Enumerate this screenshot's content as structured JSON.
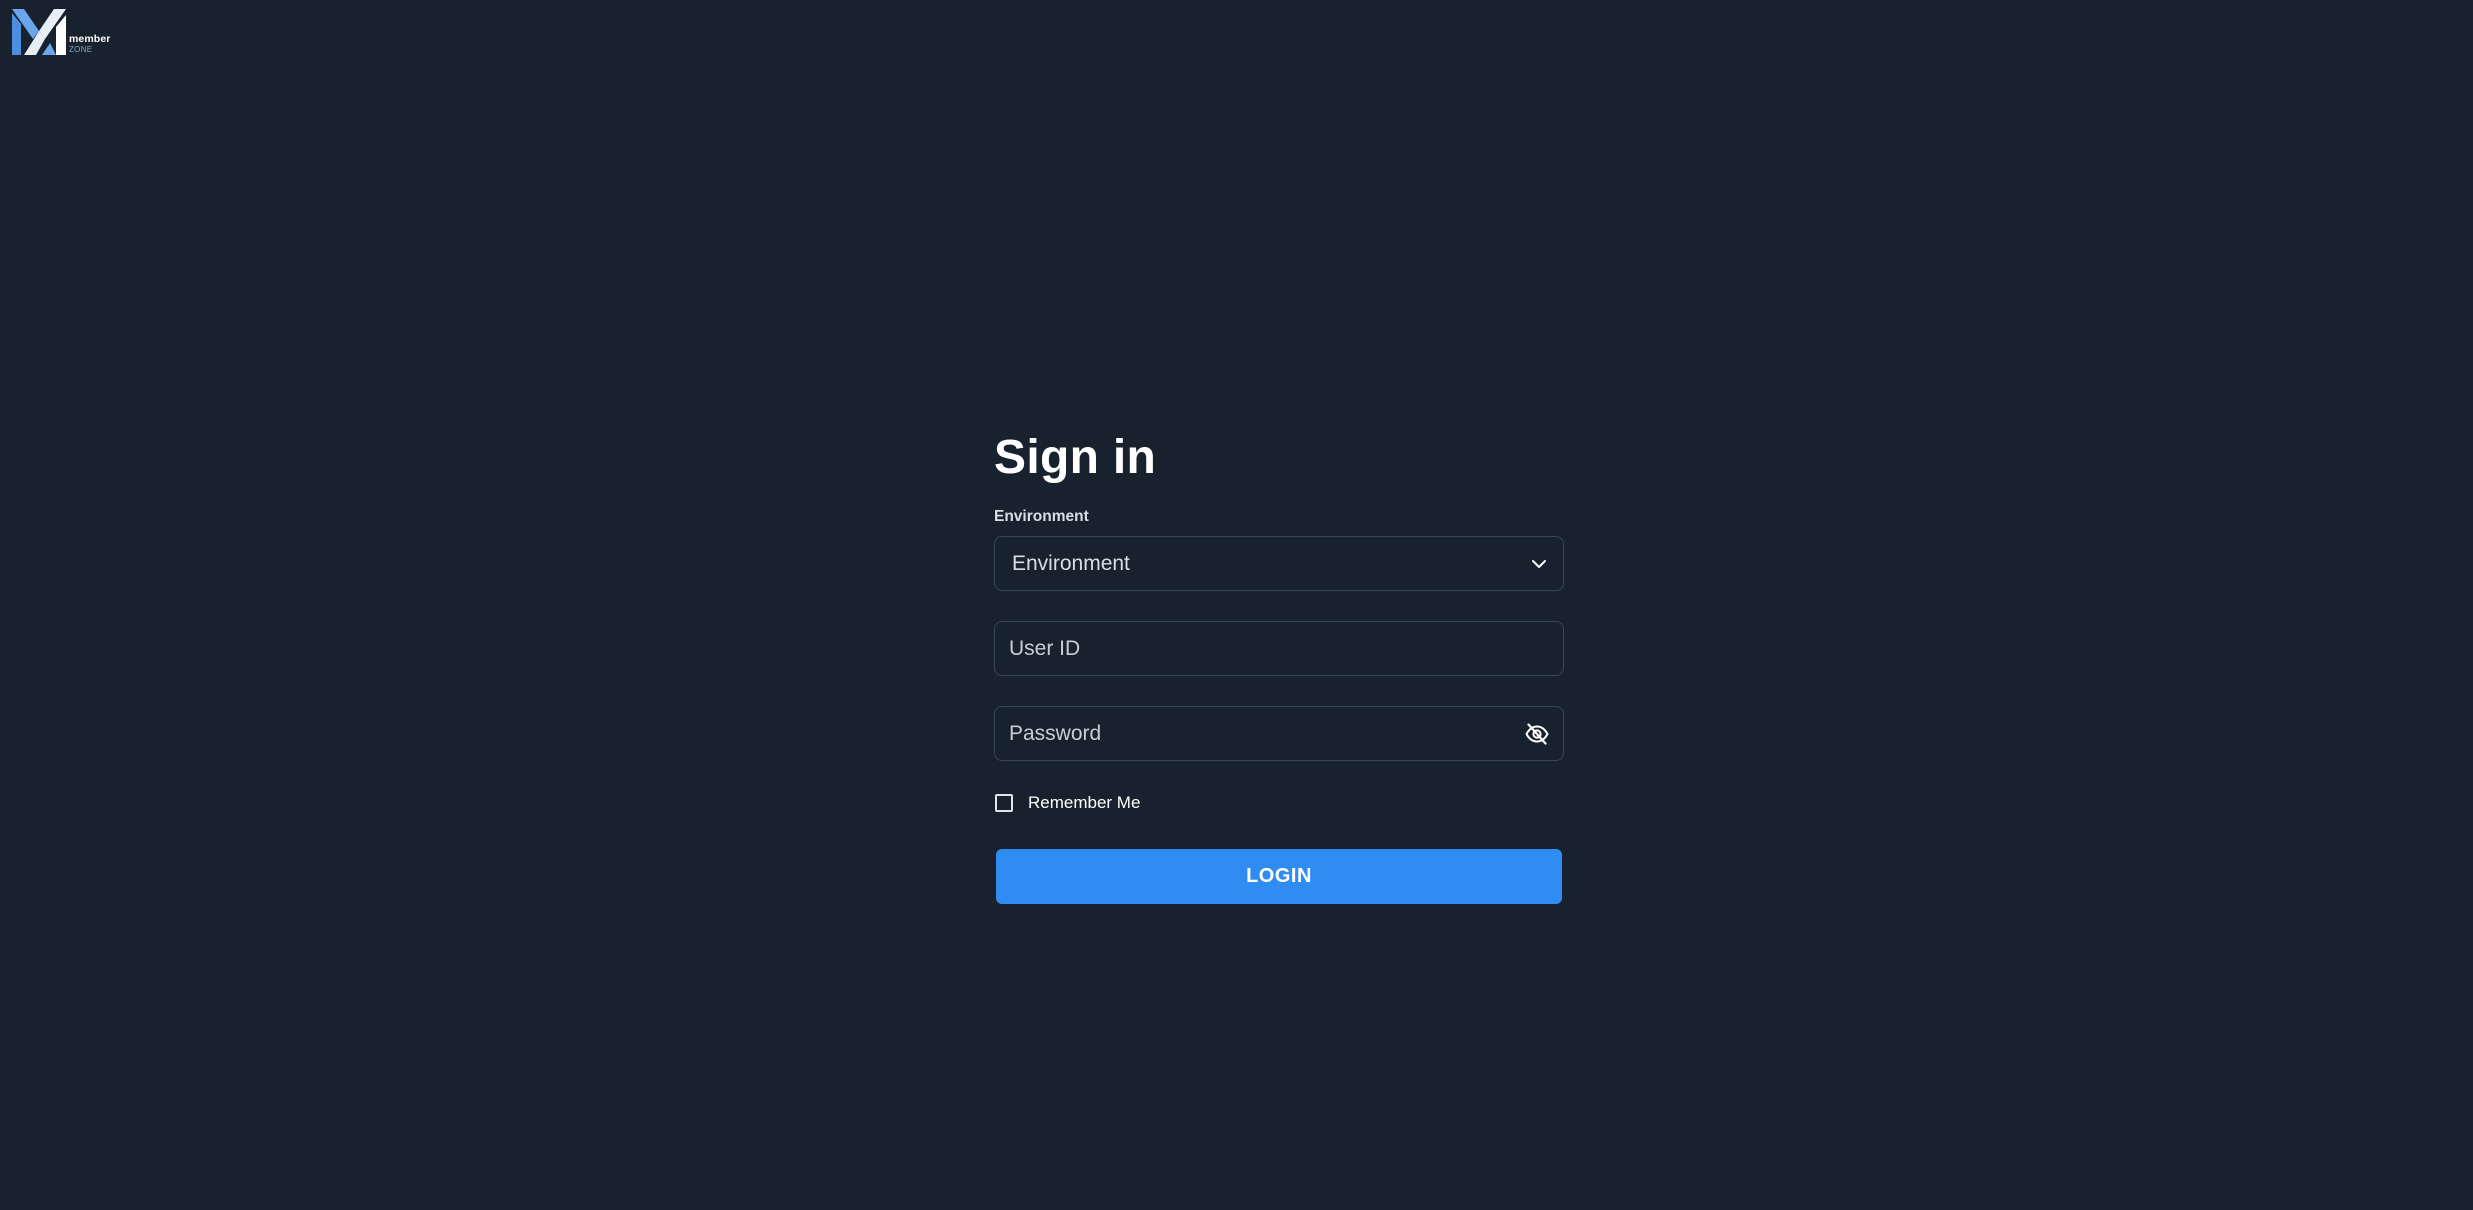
{
  "brand": {
    "logo_line1": "member",
    "logo_line2": "ZONE",
    "accent_color": "#2f8cf2",
    "background_color": "#18222f"
  },
  "form": {
    "title": "Sign in",
    "environment": {
      "label": "Environment",
      "selected_value": "Environment",
      "icon": "chevron-down-icon"
    },
    "user_id": {
      "value": "",
      "placeholder": "User ID"
    },
    "password": {
      "value": "",
      "placeholder": "Password",
      "toggle_icon": "eye-off-icon"
    },
    "remember_me": {
      "label": "Remember Me",
      "checked": false
    },
    "login_label": "LOGIN"
  }
}
